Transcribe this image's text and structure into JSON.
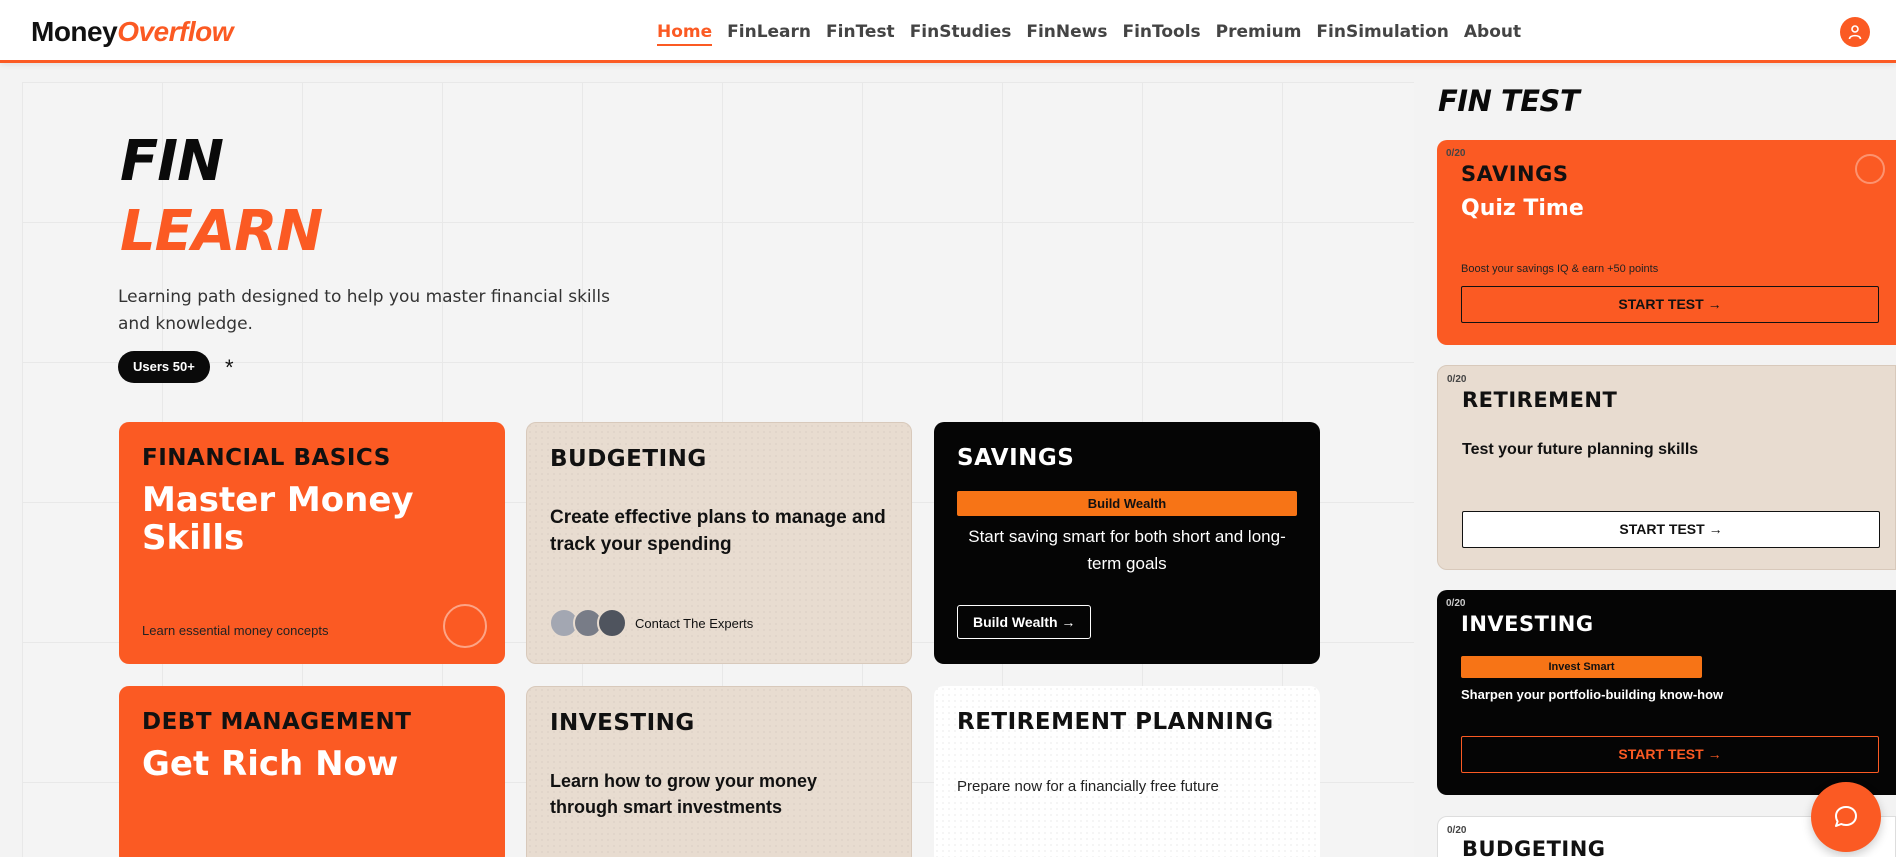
{
  "header": {
    "logo_part1": "Money",
    "logo_part2": "Overflow",
    "nav": [
      "Home",
      "FinLearn",
      "FinTest",
      "FinStudies",
      "FinNews",
      "FinTools",
      "Premium",
      "FinSimulation",
      "About"
    ],
    "active_nav": "Home",
    "user_icon": "user-icon"
  },
  "hero": {
    "title_line1": "FIN",
    "title_line2": "LEARN",
    "subtitle": "Learning path designed to help you master financial skills and knowledge.",
    "users_badge": "Users 50+",
    "asterisk": "*"
  },
  "cards": {
    "financial_basics": {
      "head": "FINANCIAL BASICS",
      "big": "Master Money Skills",
      "small": "Learn essential money concepts"
    },
    "budgeting": {
      "head": "BUDGETING",
      "text": "Create effective plans to manage and track your spending",
      "contact": "Contact The Experts"
    },
    "savings": {
      "head": "SAVINGS",
      "badge": "Build Wealth",
      "text": "Start saving smart for both short and long-term goals",
      "button": "Build Wealth →"
    },
    "debt": {
      "head": "DEBT MANAGEMENT",
      "big": "Get Rich Now"
    },
    "investing": {
      "head": "INVESTING",
      "text": "Learn how to grow your money through smart investments"
    },
    "retirement": {
      "head": "RETIREMENT PLANNING",
      "text": "Prepare now for a financially free future"
    }
  },
  "fintest": {
    "title": "FIN TEST",
    "cards": [
      {
        "count": "0/20",
        "head": "SAVINGS",
        "sub": "Quiz Time",
        "desc": "Boost your savings IQ & earn +50 points",
        "button": "START TEST →"
      },
      {
        "count": "0/20",
        "head": "RETIREMENT",
        "sub": "Test your future planning skills",
        "button": "START TEST →"
      },
      {
        "count": "0/20",
        "head": "INVESTING",
        "badge": "Invest Smart",
        "sub": "Sharpen your portfolio-building know-how",
        "button": "START TEST →"
      },
      {
        "count": "0/20",
        "head": "BUDGETING"
      }
    ]
  },
  "colors": {
    "accent": "#fb5a23",
    "beige": "#e8dcd0",
    "black": "#050505",
    "badge_orange": "#f77416"
  }
}
